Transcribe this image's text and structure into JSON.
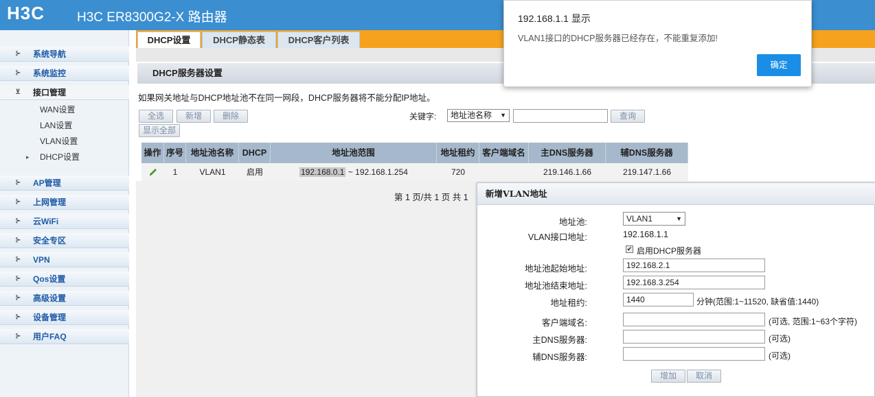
{
  "header": {
    "logo": "H3C",
    "product": "H3C ER8300G2-X 路由器"
  },
  "sidebar": {
    "items": [
      {
        "label": "系统导航"
      },
      {
        "label": "系统监控"
      },
      {
        "label": "接口管理"
      },
      {
        "label": "AP管理"
      },
      {
        "label": "上网管理"
      },
      {
        "label": "云WiFi"
      },
      {
        "label": "安全专区"
      },
      {
        "label": "VPN"
      },
      {
        "label": "Qos设置"
      },
      {
        "label": "高级设置"
      },
      {
        "label": "设备管理"
      },
      {
        "label": "用户FAQ"
      }
    ],
    "subitems": [
      {
        "label": "WAN设置"
      },
      {
        "label": "LAN设置"
      },
      {
        "label": "VLAN设置"
      },
      {
        "label": "DHCP设置"
      }
    ]
  },
  "tabs": [
    {
      "label": "DHCP设置"
    },
    {
      "label": "DHCP静态表"
    },
    {
      "label": "DHCP客户列表"
    }
  ],
  "section": {
    "title": "DHCP服务器设置",
    "notice": "如果网关地址与DHCP地址池不在同一网段，DHCP服务器将不能分配IP地址。"
  },
  "toolbar": {
    "select_all": "全选",
    "add": "新增",
    "delete": "删除",
    "show_all": "显示全部",
    "keyword_label": "关键字:",
    "keyword_option": "地址池名称",
    "search": "查询"
  },
  "table": {
    "headers": [
      "操作",
      "序号",
      "地址池名称",
      "DHCP",
      "地址池范围",
      "地址租约",
      "客户端域名",
      "主DNS服务器",
      "辅DNS服务器"
    ],
    "row": {
      "index": "1",
      "name": "VLAN1",
      "dhcp": "启用",
      "range_start": "192.168.0.1",
      "range_rest": "~ 192.168.1.254",
      "lease": "720",
      "domain": "",
      "dns1": "219.146.1.66",
      "dns2": "219.147.1.66"
    }
  },
  "pager": {
    "text": "第 1 页/共 1 页 共 1"
  },
  "dialog": {
    "title": "新增VLAN地址",
    "pool_label": "地址池:",
    "pool_value": "VLAN1",
    "vlan_ip_label": "VLAN接口地址:",
    "vlan_ip_value": "192.168.1.1",
    "enable_dhcp_label": "启用DHCP服务器",
    "start_label": "地址池起始地址:",
    "start_value": "192.168.2.1",
    "end_label": "地址池结束地址:",
    "end_value": "192.168.3.254",
    "lease_label": "地址租约:",
    "lease_value": "1440",
    "lease_hint": "分钟(范围:1~11520, 缺省值:1440)",
    "domain_label": "客户端域名:",
    "domain_value": "",
    "domain_hint": "(可选, 范围:1~63个字符)",
    "dns1_label": "主DNS服务器:",
    "dns1_value": "",
    "dns1_hint": "(可选)",
    "dns2_label": "辅DNS服务器:",
    "dns2_value": "",
    "dns2_hint": "(可选)",
    "add_button": "增加",
    "cancel_button": "取消"
  },
  "alert": {
    "title": "192.168.1.1 显示",
    "message": "VLAN1接口的DHCP服务器已经存在，不能重复添加!",
    "ok": "确定"
  },
  "colors": {
    "header": "#3b8ed0",
    "tabbar": "#f7a21e",
    "table_header": "#a6b9cc",
    "alert_button": "#1a8ee6"
  }
}
